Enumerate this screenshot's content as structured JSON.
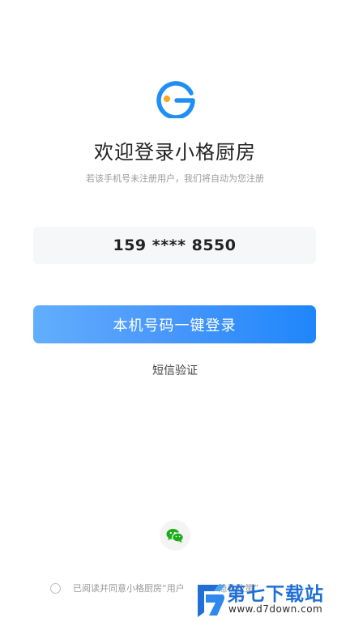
{
  "app": {
    "title": "欢迎登录小格厨房",
    "subtitle": "若该手机号未注册用户，我们将自动为您注册",
    "logo_icon": "g-logo-icon",
    "accent_color": "#1f86fb"
  },
  "phone": {
    "masked_number": "159 **** 8550"
  },
  "actions": {
    "one_click_login_label": "本机号码一键登录",
    "sms_verify_label": "短信验证",
    "wechat_icon": "wechat-icon",
    "wechat_color": "#1aad19"
  },
  "agreement": {
    "checked": false,
    "prefix": "已阅读并同意小格厨房",
    "user_link": "“用户",
    "privacy_link": "“隐私政策”"
  },
  "watermark": {
    "title": "第七下载站",
    "url": "www.d7down.com"
  }
}
